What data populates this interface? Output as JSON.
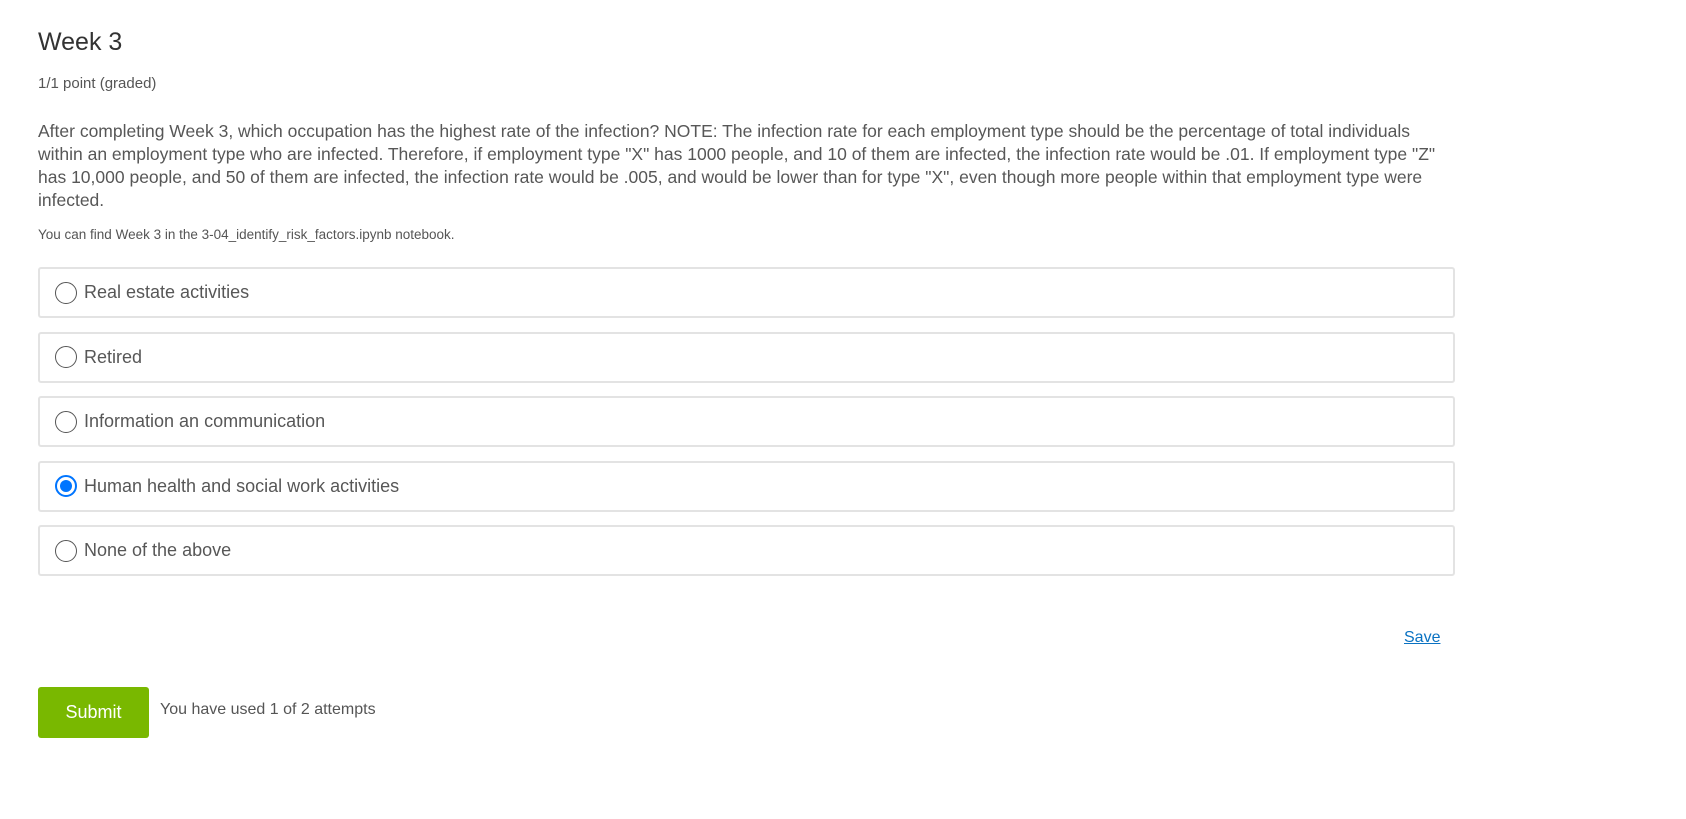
{
  "problem": {
    "title": "Week 3",
    "points": "1/1 point (graded)",
    "question": "After completing Week 3, which occupation has the highest rate of the infection? NOTE: The infection rate for each employment type should be the percentage of total individuals within an employment type who are infected. Therefore, if employment type \"X\" has 1000 people, and 10 of them are infected, the infection rate would be .01. If employment type \"Z\" has 10,000 people, and 50 of them are infected, the infection rate would be .005, and would be lower than for type \"X\", even though more people within that employment type were infected.",
    "note": "You can find Week 3 in the 3-04_identify_risk_factors.ipynb notebook.",
    "options": [
      {
        "label": "Real estate activities",
        "selected": false
      },
      {
        "label": "Retired",
        "selected": false
      },
      {
        "label": "Information an communication",
        "selected": false
      },
      {
        "label": "Human health and social work activities",
        "selected": true
      },
      {
        "label": "None of the above",
        "selected": false
      }
    ]
  },
  "actions": {
    "save_label": "Save",
    "submit_label": "Submit",
    "attempts_text": "You have used 1 of 2 attempts"
  },
  "colors": {
    "submit": "#79b800",
    "link": "#0a72c2",
    "radio_selected": "#0075ff"
  }
}
